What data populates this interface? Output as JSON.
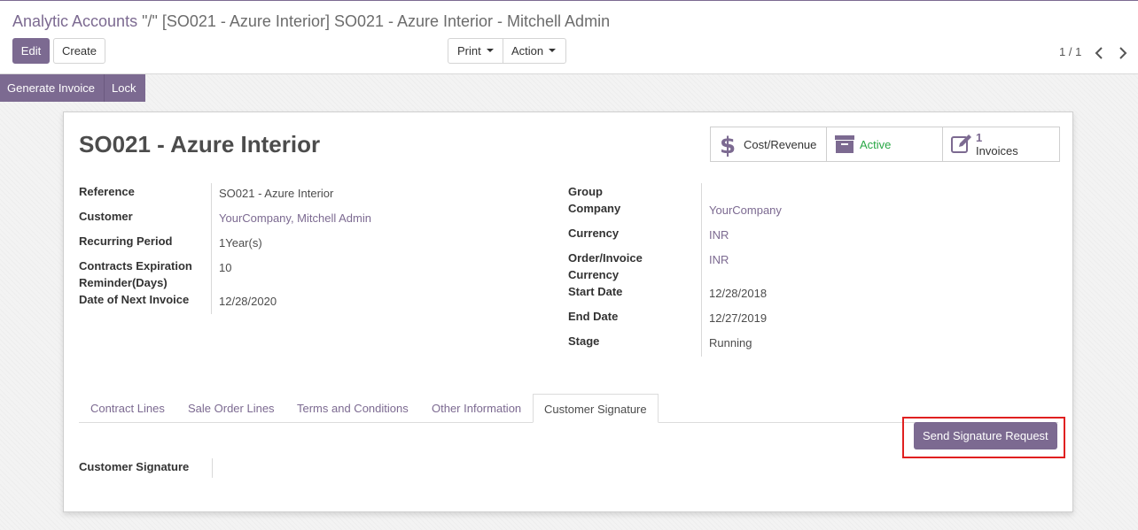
{
  "breadcrumb": {
    "parent": "Analytic Accounts",
    "current": " \"/\" [SO021 - Azure Interior] SO021 - Azure Interior - Mitchell Admin"
  },
  "toolbar": {
    "edit_label": "Edit",
    "create_label": "Create",
    "print_label": "Print",
    "action_label": "Action"
  },
  "pager": {
    "value": "1 / 1"
  },
  "statusbar": {
    "generate_invoice_label": "Generate Invoice",
    "lock_label": "Lock"
  },
  "record": {
    "title": "SO021 - Azure Interior",
    "smart_buttons": {
      "cost_revenue": "Cost/Revenue",
      "active": "Active",
      "invoices_count": "1",
      "invoices_label": "Invoices"
    },
    "left_fields": {
      "reference_label": "Reference",
      "reference_value": "SO021 - Azure Interior",
      "customer_label": "Customer",
      "customer_value": "YourCompany, Mitchell Admin",
      "recurring_label": "Recurring Period",
      "recurring_value": "1Year(s)",
      "reminder_label": "Contracts Expiration Reminder(Days)",
      "reminder_value": "10",
      "next_invoice_label": "Date of Next Invoice",
      "next_invoice_value": "12/28/2020"
    },
    "right_fields": {
      "group_label": "Group",
      "company_label": "Company",
      "company_value": "YourCompany",
      "currency_label": "Currency",
      "currency_value": "INR",
      "order_currency_label": "Order/Invoice Currency",
      "order_currency_value": "INR",
      "start_label": "Start Date",
      "start_value": "12/28/2018",
      "end_label": "End Date",
      "end_value": "12/27/2019",
      "stage_label": "Stage",
      "stage_value": "Running"
    },
    "tabs": [
      "Contract Lines",
      "Sale Order Lines",
      "Terms and Conditions",
      "Other Information",
      "Customer Signature"
    ],
    "send_signature_label": "Send Signature Request",
    "customer_signature_label": "Customer Signature"
  },
  "colors": {
    "brand": "#7c6a91",
    "active_status": "#28a745",
    "highlight_border": "#e02020"
  }
}
